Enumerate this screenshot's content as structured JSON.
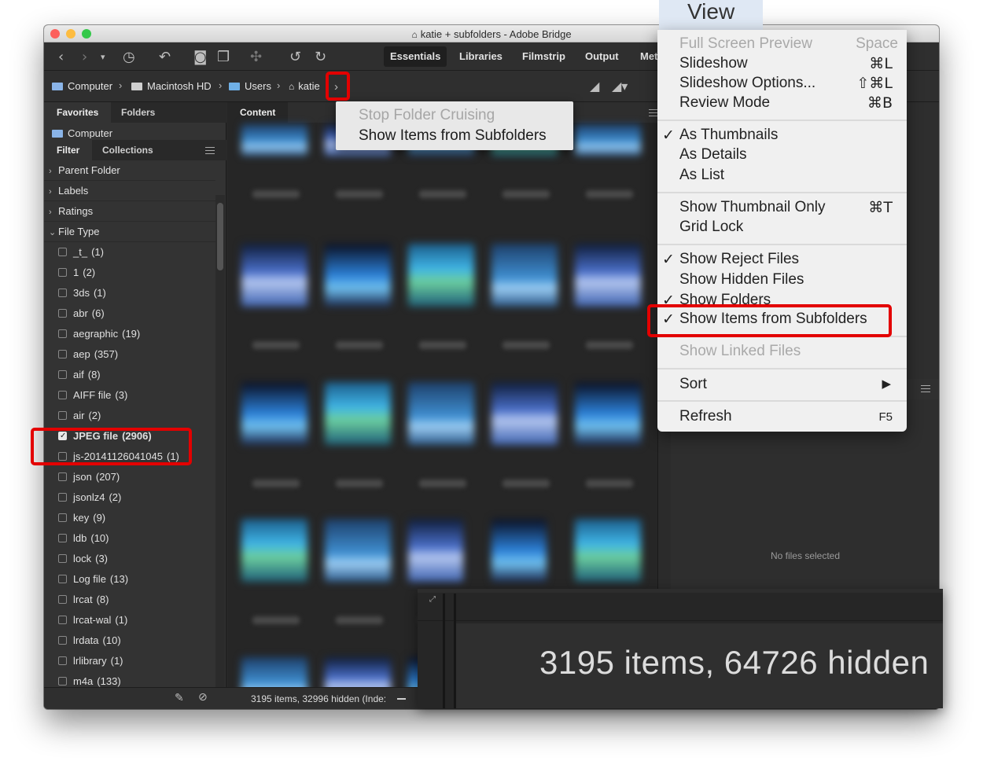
{
  "window": {
    "title": "katie + subfolders - Adobe Bridge",
    "traffic_colors": [
      "#fc605c",
      "#fdbc40",
      "#34c84a"
    ]
  },
  "toolbar": {
    "workspaces": [
      "Essentials",
      "Libraries",
      "Filmstrip",
      "Output",
      "Met"
    ]
  },
  "pathbar": {
    "crumbs": [
      "Computer",
      "Macintosh HD",
      "Users",
      "katie"
    ],
    "more_icon": "chevron-right-icon"
  },
  "left_panel": {
    "tabs_top": [
      "Favorites",
      "Folders"
    ],
    "favorites_first": "Computer",
    "tabs_bottom": [
      "Filter",
      "Collections"
    ],
    "filter_sections": [
      "Parent Folder",
      "Labels",
      "Ratings",
      "File Type"
    ],
    "file_types": [
      {
        "label": "_t_",
        "count": "(1)",
        "checked": false
      },
      {
        "label": "1",
        "count": "(2)",
        "checked": false
      },
      {
        "label": "3ds",
        "count": "(1)",
        "checked": false
      },
      {
        "label": "abr",
        "count": "(6)",
        "checked": false
      },
      {
        "label": "aegraphic",
        "count": "(19)",
        "checked": false
      },
      {
        "label": "aep",
        "count": "(357)",
        "checked": false
      },
      {
        "label": "aif",
        "count": "(8)",
        "checked": false
      },
      {
        "label": "AIFF file",
        "count": "(3)",
        "checked": false
      },
      {
        "label": "air",
        "count": "(2)",
        "checked": false
      },
      {
        "label": "JPEG file",
        "count": "(2906)",
        "checked": true
      },
      {
        "label": "js-20141126041045",
        "count": "(1)",
        "checked": false
      },
      {
        "label": "json",
        "count": "(207)",
        "checked": false
      },
      {
        "label": "jsonlz4",
        "count": "(2)",
        "checked": false
      },
      {
        "label": "key",
        "count": "(9)",
        "checked": false
      },
      {
        "label": "ldb",
        "count": "(10)",
        "checked": false
      },
      {
        "label": "lock",
        "count": "(3)",
        "checked": false
      },
      {
        "label": "Log file",
        "count": "(13)",
        "checked": false
      },
      {
        "label": "lrcat",
        "count": "(8)",
        "checked": false
      },
      {
        "label": "lrcat-wal",
        "count": "(1)",
        "checked": false
      },
      {
        "label": "lrdata",
        "count": "(10)",
        "checked": false
      },
      {
        "label": "lrlibrary",
        "count": "(1)",
        "checked": false
      },
      {
        "label": "m4a",
        "count": "(133)",
        "checked": false
      }
    ]
  },
  "content": {
    "tab": "Content",
    "status": "3195 items, 32996 hidden (Inde:"
  },
  "cruise_popup": {
    "stop": "Stop Folder Cruising",
    "show": "Show Items from Subfolders"
  },
  "right_panel": {
    "empty": "No files selected"
  },
  "zoom_status": "3195 items, 64726 hidden",
  "view_menu": {
    "title": "View",
    "items": {
      "full_screen": {
        "label": "Full Screen Preview",
        "shortcut": "Space"
      },
      "slideshow": {
        "label": "Slideshow",
        "shortcut": "⌘L"
      },
      "slideshow_options": {
        "label": "Slideshow Options...",
        "shortcut": "⇧⌘L"
      },
      "review_mode": {
        "label": "Review Mode",
        "shortcut": "⌘B"
      },
      "as_thumbnails": {
        "label": "As Thumbnails"
      },
      "as_details": {
        "label": "As Details"
      },
      "as_list": {
        "label": "As List"
      },
      "thumb_only": {
        "label": "Show Thumbnail Only",
        "shortcut": "⌘T"
      },
      "grid_lock": {
        "label": "Grid Lock"
      },
      "reject_files": {
        "label": "Show Reject Files"
      },
      "hidden_files": {
        "label": "Show Hidden Files"
      },
      "show_folders": {
        "label": "Show Folders"
      },
      "show_subfolders": {
        "label": "Show Items from Subfolders"
      },
      "linked_files": {
        "label": "Show Linked Files"
      },
      "sort": {
        "label": "Sort",
        "shortcut": "▶"
      },
      "refresh": {
        "label": "Refresh",
        "shortcut": "F5"
      }
    },
    "check_mark": "✓"
  },
  "highlight_color": "#e30000"
}
